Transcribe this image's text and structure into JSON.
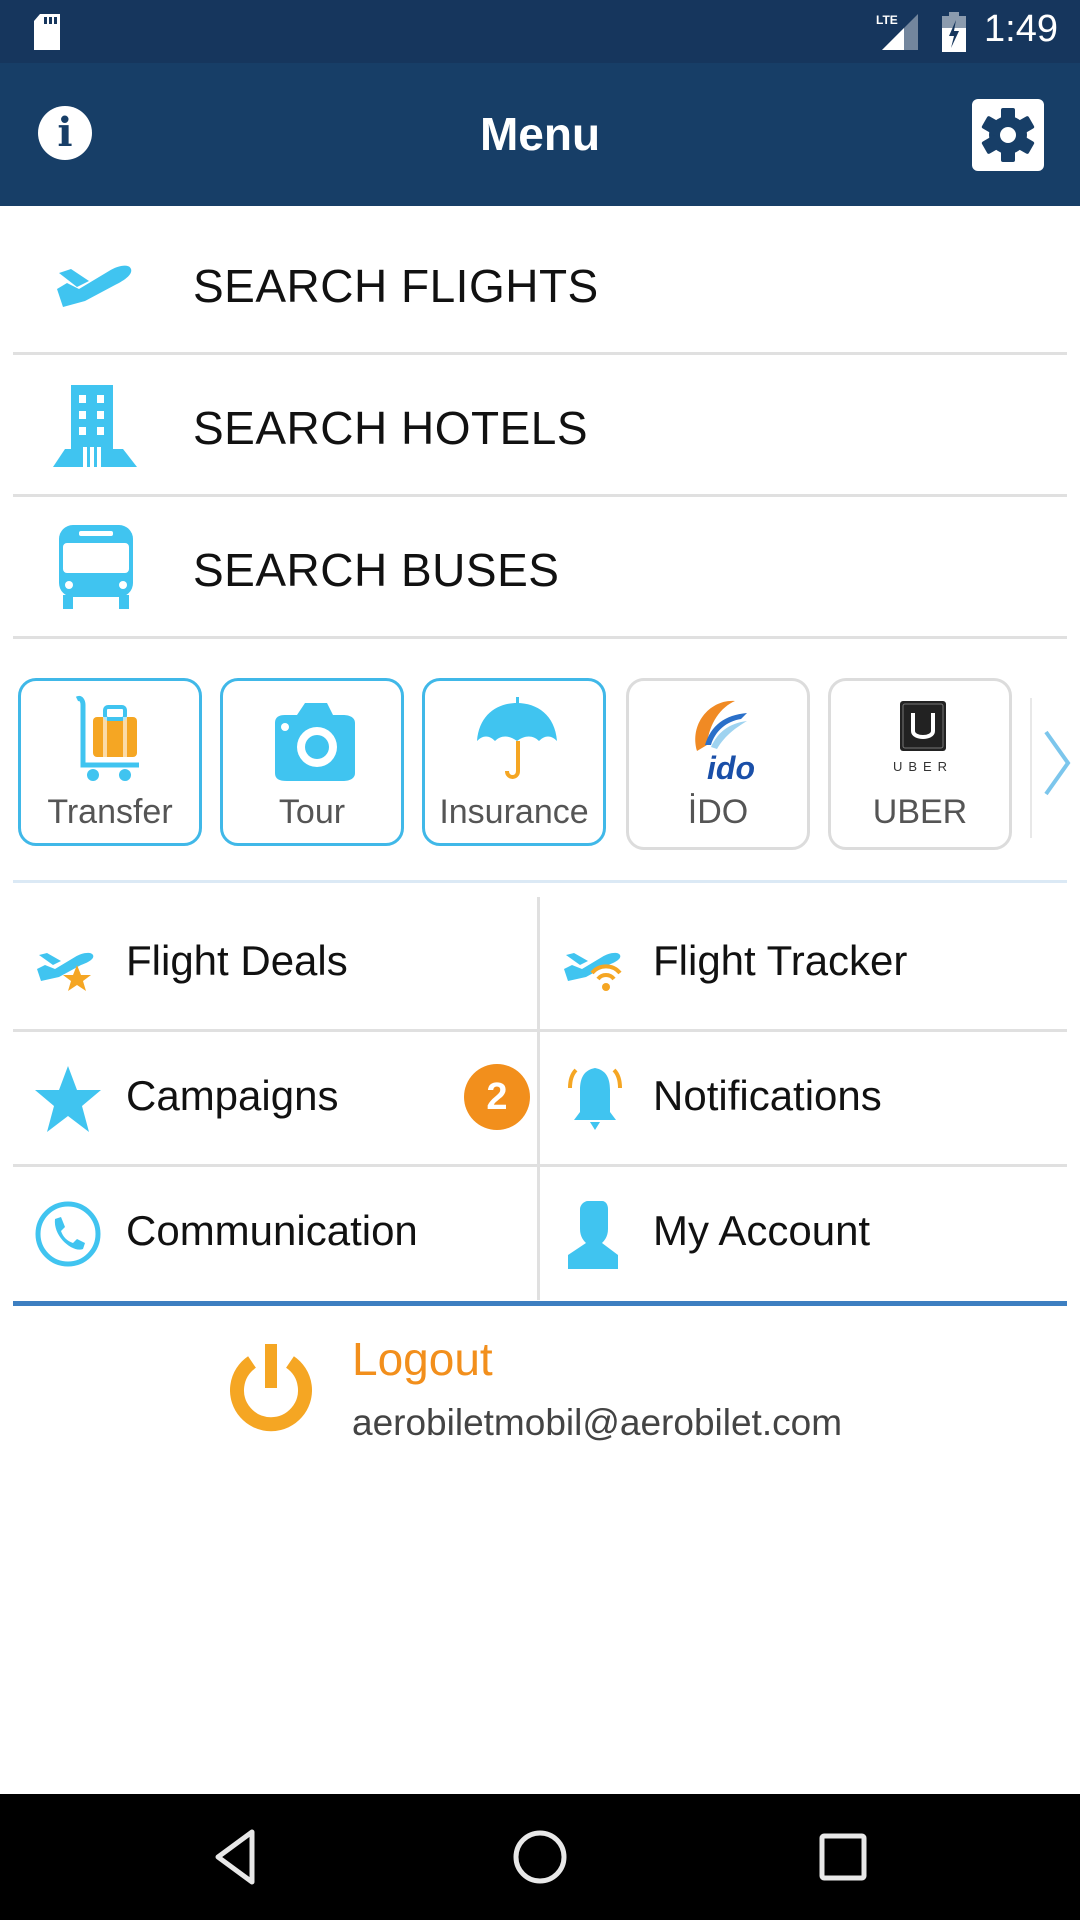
{
  "status_bar": {
    "time": "1:49",
    "network": "LTE",
    "icons": [
      "sd-card-icon",
      "signal-icon",
      "battery-charging-icon"
    ]
  },
  "toolbar": {
    "title": "Menu",
    "left_icon": "info-icon",
    "right_icon": "gear-icon"
  },
  "search_items": [
    {
      "label": "SEARCH FLIGHTS",
      "icon": "airplane-icon"
    },
    {
      "label": "SEARCH HOTELS",
      "icon": "hotel-building-icon"
    },
    {
      "label": "SEARCH BUSES",
      "icon": "bus-icon"
    }
  ],
  "services": [
    {
      "label": "Transfer",
      "icon": "luggage-cart-icon"
    },
    {
      "label": "Tour",
      "icon": "camera-icon"
    },
    {
      "label": "Insurance",
      "icon": "umbrella-icon"
    },
    {
      "label": "İDO",
      "icon": "ido-logo-icon",
      "logo_text": "ido"
    },
    {
      "label": "UBER",
      "icon": "uber-logo-icon",
      "logo_text": "UBER"
    }
  ],
  "grid_items": [
    {
      "label": "Flight Deals",
      "icon": "flight-deals-icon"
    },
    {
      "label": "Flight Tracker",
      "icon": "flight-tracker-icon"
    },
    {
      "label": "Campaigns",
      "icon": "star-icon",
      "badge": "2"
    },
    {
      "label": "Notifications",
      "icon": "bell-icon"
    },
    {
      "label": "Communication",
      "icon": "phone-icon"
    },
    {
      "label": "My Account",
      "icon": "user-icon"
    }
  ],
  "logout": {
    "label": "Logout",
    "email": "aerobiletmobil@aerobilet.com"
  },
  "colors": {
    "primary_dark": "#173e67",
    "accent_blue": "#40c4f0",
    "accent_orange": "#f28f1c",
    "divider_blue": "#3d7fc1"
  }
}
